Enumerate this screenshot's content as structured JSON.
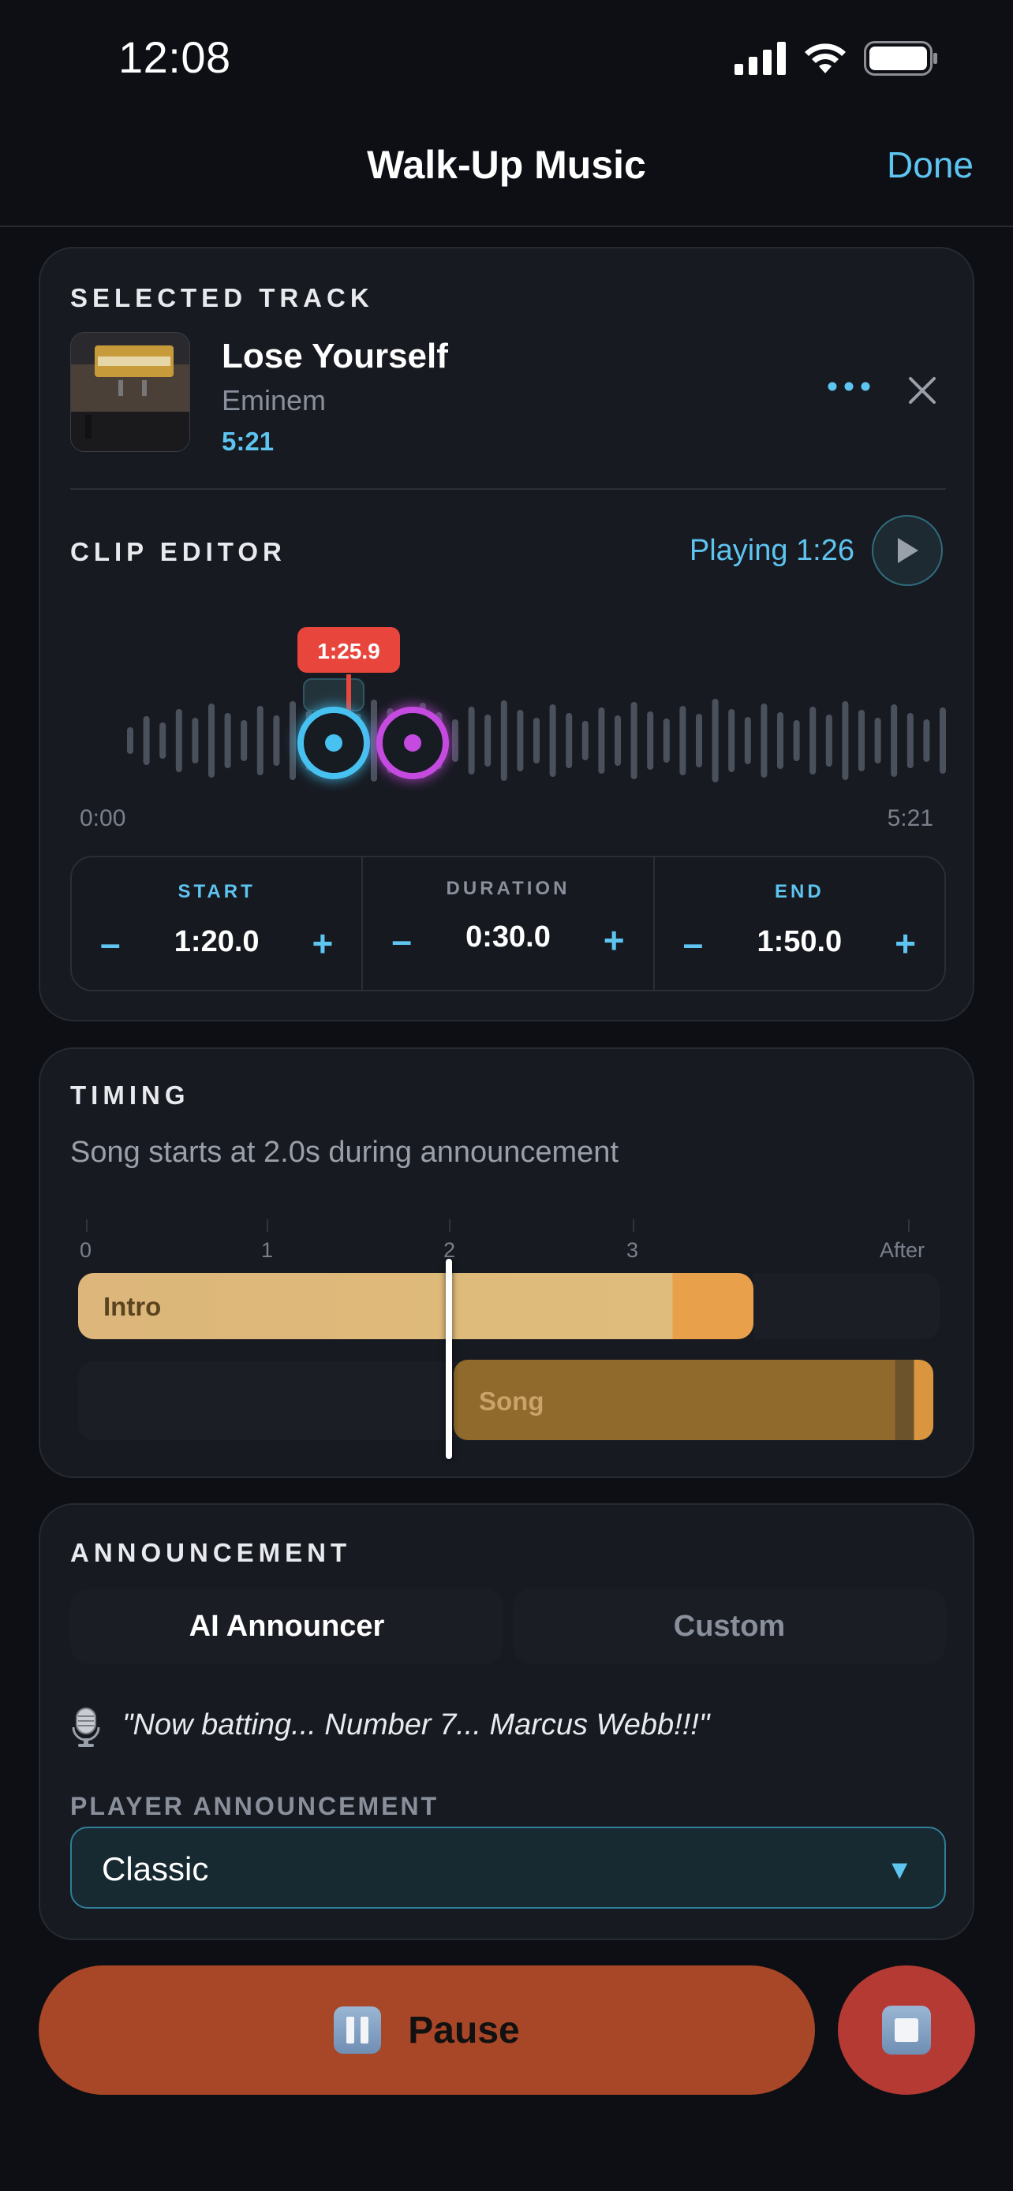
{
  "status_bar": {
    "time": "12:08"
  },
  "nav": {
    "title": "Walk-Up Music",
    "done_label": "Done"
  },
  "selected_track": {
    "section_label": "SELECTED TRACK",
    "title": "Lose Yourself",
    "artist": "Eminem",
    "length": "5:21"
  },
  "clip_editor": {
    "section_label": "CLIP EDITOR",
    "playing_status": "Playing 1:26",
    "playhead_tooltip": "1:25.9",
    "timeline_start": "0:00",
    "timeline_end": "5:21",
    "start": {
      "label": "START",
      "value": "1:20.0",
      "minus": "–",
      "plus": "+"
    },
    "duration": {
      "label": "DURATION",
      "value": "0:30.0",
      "minus": "–",
      "plus": "+"
    },
    "end": {
      "label": "END",
      "value": "1:50.0",
      "minus": "–",
      "plus": "+"
    }
  },
  "timing": {
    "section_label": "TIMING",
    "description": "Song starts at 2.0s during announcement",
    "ticks": [
      "0",
      "1",
      "2",
      "3",
      "After"
    ],
    "intro_label": "Intro",
    "song_label": "Song"
  },
  "announcement": {
    "section_label": "ANNOUNCEMENT",
    "tabs": [
      {
        "label": "AI Announcer",
        "selected": true
      },
      {
        "label": "Custom",
        "selected": false
      }
    ],
    "quote": "\"Now batting... Number 7... Marcus Webb!!!\"",
    "player_label": "PLAYER ANNOUNCEMENT",
    "selected_style": "Classic"
  },
  "controls": {
    "pause_label": "Pause"
  },
  "colors": {
    "accent": "#5ec4f0",
    "start_handle": "#46c1f0",
    "end_handle": "#c54be0",
    "playhead": "#e8453c",
    "pause_button": "#a84727",
    "stop_button": "#b53a34"
  }
}
